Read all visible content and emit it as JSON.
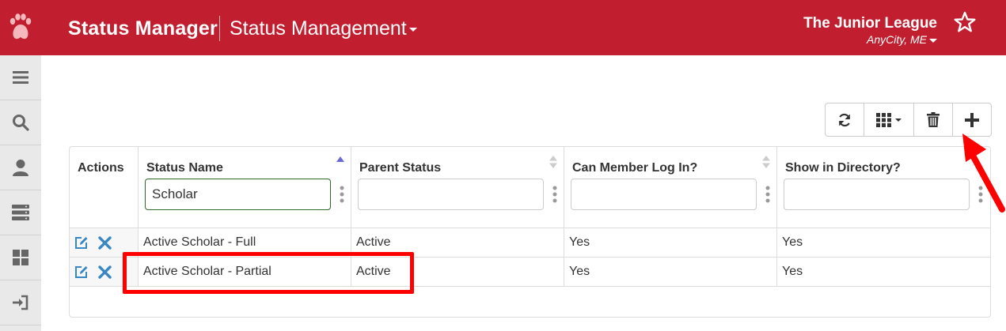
{
  "header": {
    "app_title": "Status Manager",
    "section_title": "Status Management",
    "org_name": "The Junior League",
    "org_location": "AnyCity, ME",
    "bg_color": "#c11f2f"
  },
  "sidebar": {
    "items": [
      "menu-icon",
      "search-icon",
      "user-icon",
      "server-icon",
      "dashboard-icon",
      "sign-in-icon"
    ]
  },
  "toolbar": {
    "buttons": [
      "refresh-icon",
      "columns-icon",
      "trash-icon",
      "plus-icon"
    ]
  },
  "table": {
    "columns": [
      {
        "label": "Actions"
      },
      {
        "label": "Status Name",
        "filter_value": "Scholar",
        "sort": "asc"
      },
      {
        "label": "Parent Status",
        "filter_value": ""
      },
      {
        "label": "Can Member Log In?",
        "filter_value": ""
      },
      {
        "label": "Show in Directory?",
        "filter_value": ""
      }
    ],
    "rows": [
      {
        "status_name": "Active Scholar - Full",
        "parent_status": "Active",
        "can_log_in": "Yes",
        "show_in_directory": "Yes"
      },
      {
        "status_name": "Active Scholar - Partial",
        "parent_status": "Active",
        "can_log_in": "Yes",
        "show_in_directory": "Yes"
      }
    ]
  },
  "annotation_color": "#ff0000"
}
